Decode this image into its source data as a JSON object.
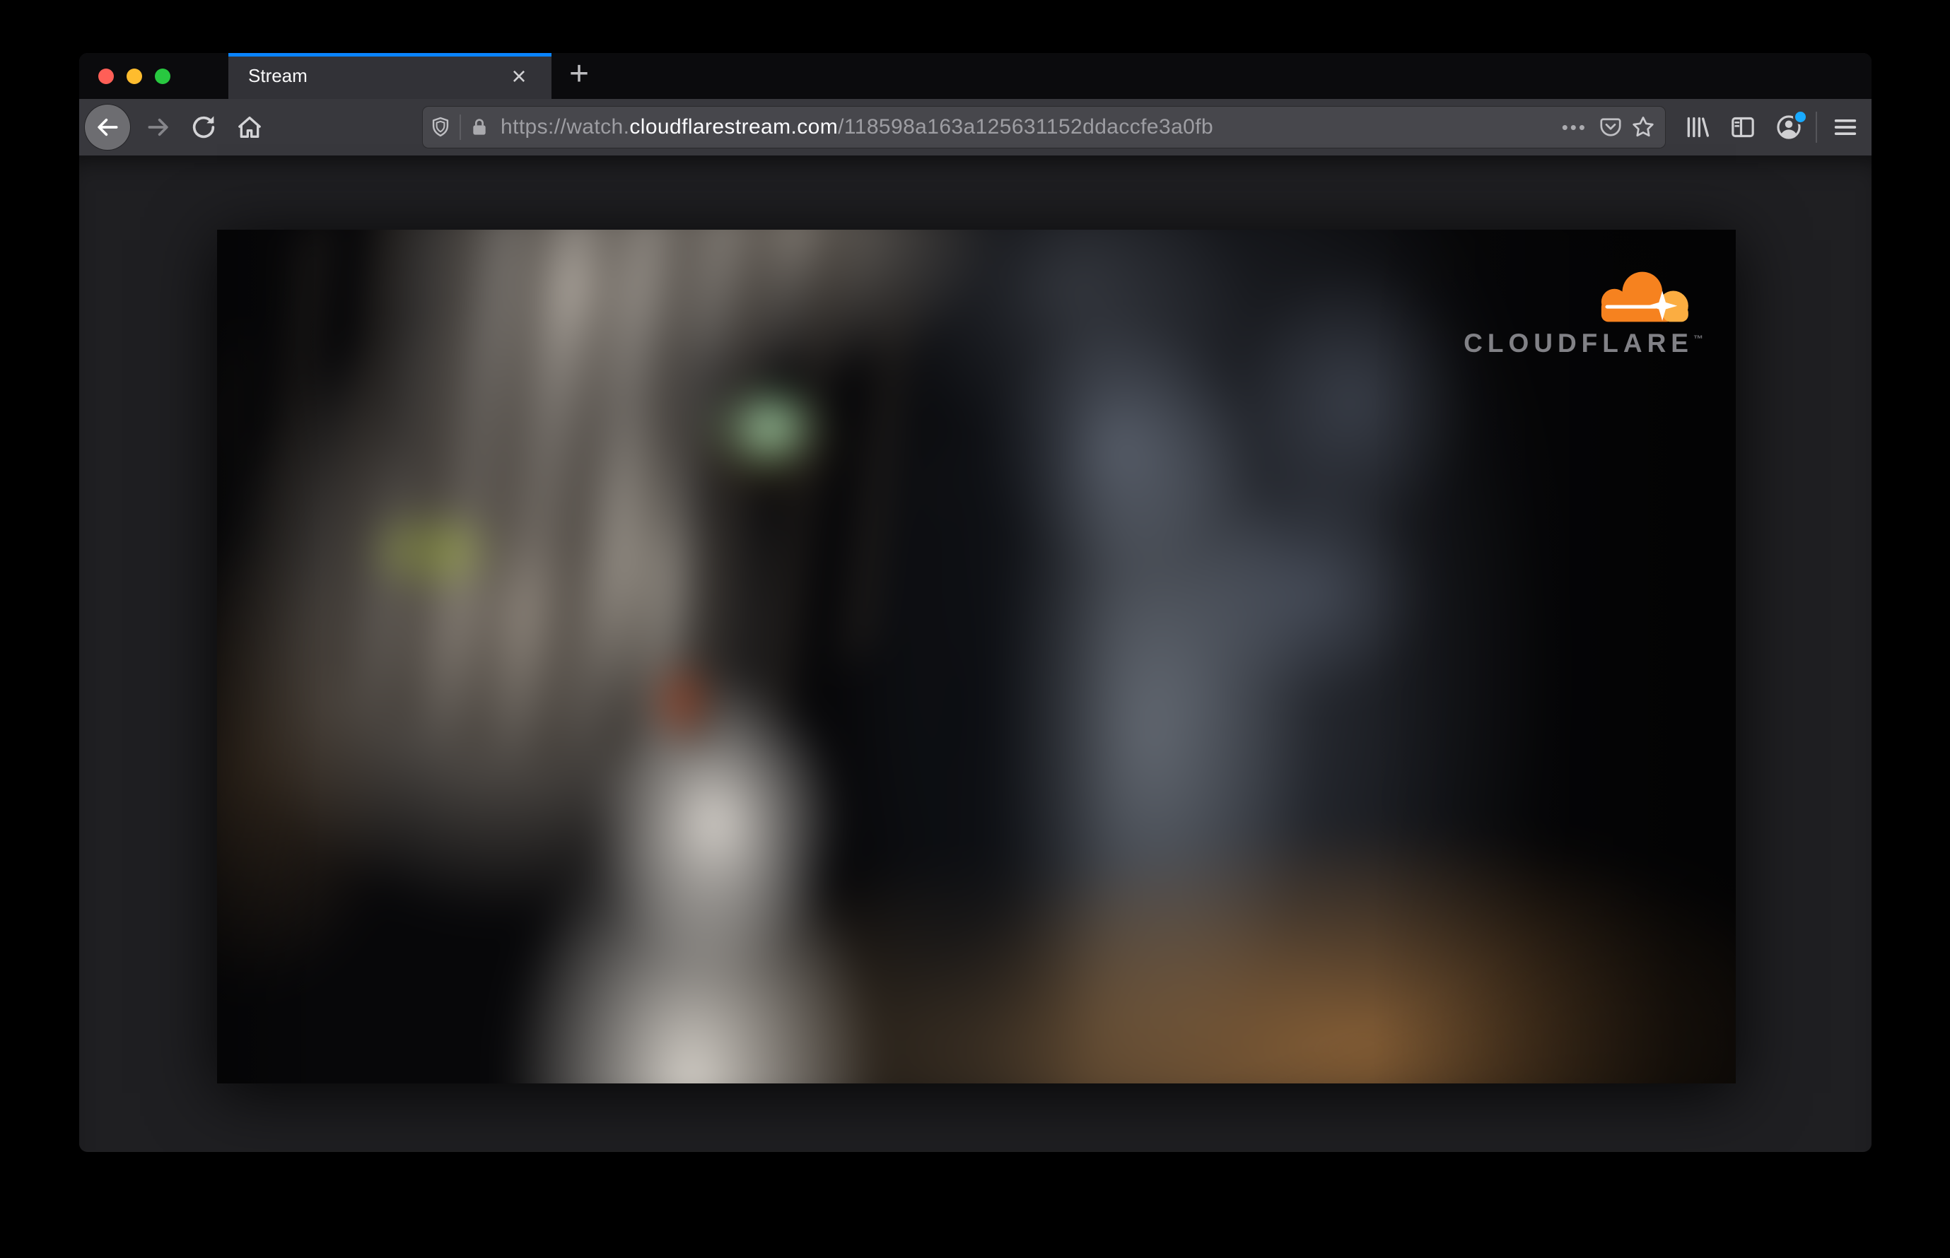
{
  "browser": {
    "traffic_lights": {
      "close_color": "#ff5f57",
      "minimize_color": "#febc2e",
      "zoom_color": "#28c840"
    },
    "tab_bar": {
      "active_tab": {
        "title": "Stream",
        "close_glyph": "×",
        "accent_color": "#0a84ff"
      },
      "new_tab_glyph": "+"
    },
    "toolbar": {
      "icons": {
        "back": "back-arrow",
        "forward": "forward-arrow",
        "reload": "reload-circular-arrow",
        "home": "home-house",
        "library": "library-books",
        "sidebar": "sidebar-panel",
        "account": "account-profile-circle",
        "menu": "hamburger-menu"
      },
      "account_has_notification": true,
      "url_bar": {
        "shield_icon": "tracking-protection-shield",
        "lock_icon": "https-padlock",
        "scheme_subdomain": "https://watch.",
        "domain": "cloudflarestream.com",
        "path": "/118598a163a125631152ddaccfe3a0fb",
        "page_actions_glyph": "•••",
        "pocket_icon": "save-to-pocket",
        "bookmark_icon": "bookmark-star"
      }
    }
  },
  "content": {
    "video_player": {
      "scene_description": "blurred close-up of a gray tabby cat with green eyes",
      "watermark": {
        "brand": "CLOUDFLARE",
        "trademark": "™",
        "cloud_primary": "#f6821f",
        "cloud_secondary": "#fbad41",
        "wordmark_color": "#818186"
      }
    }
  }
}
